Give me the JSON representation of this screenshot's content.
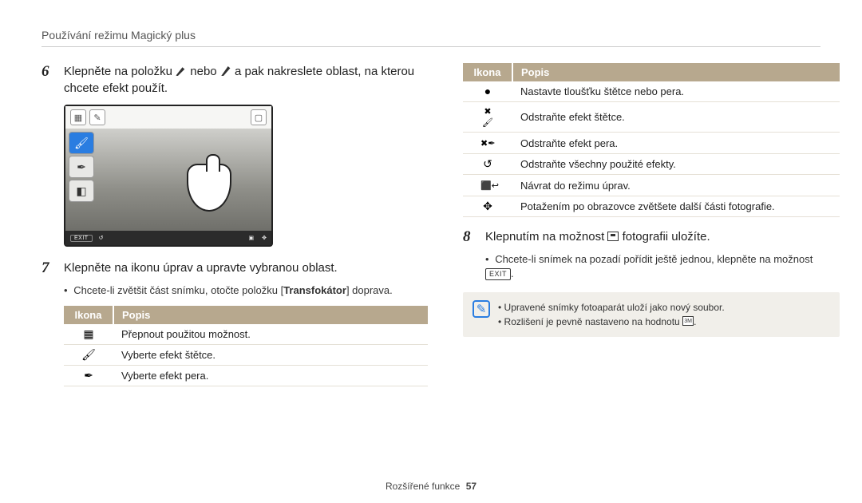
{
  "header": {
    "title": "Používání režimu Magický plus"
  },
  "left": {
    "step6": {
      "num": "6",
      "text_a": "Klepněte na položku",
      "text_b": "nebo",
      "text_c": "a pak nakreslete oblast, na kterou chcete efekt použít."
    },
    "illustration": {
      "bottom_exit": "EXIT"
    },
    "step7": {
      "num": "7",
      "text": "Klepněte na ikonu úprav a upravte vybranou oblast."
    },
    "bullet7": {
      "text_a": "Chcete-li zvětšit část snímku, otočte položku [",
      "strong": "Transfokátor",
      "text_b": "] doprava."
    },
    "table1": {
      "h1": "Ikona",
      "h2": "Popis",
      "rows": [
        {
          "glyph": "▦",
          "text": "Přepnout použitou možnost."
        },
        {
          "glyph": "🖌",
          "text": "Vyberte efekt štětce."
        },
        {
          "glyph": "✒",
          "text": "Vyberte efekt pera."
        }
      ]
    }
  },
  "right": {
    "table2": {
      "h1": "Ikona",
      "h2": "Popis",
      "rows": [
        {
          "glyph": "●",
          "text": "Nastavte tloušťku štětce nebo pera."
        },
        {
          "glyph": "✖🖌",
          "text": "Odstraňte efekt štětce."
        },
        {
          "glyph": "✖✒",
          "text": "Odstraňte efekt pera."
        },
        {
          "glyph": "↺",
          "text": "Odstraňte všechny použité efekty."
        },
        {
          "glyph": "⬛↩",
          "text": "Návrat do režimu úprav."
        },
        {
          "glyph": "✥",
          "text": "Potažením po obrazovce zvětšete další části fotografie."
        }
      ]
    },
    "step8": {
      "num": "8",
      "text_a": "Klepnutím na možnost",
      "text_b": "fotografii uložíte."
    },
    "bullet8": {
      "text": "Chcete-li snímek na pozadí pořídit ještě jednou, klepněte na možnost",
      "btn": "EXIT",
      "tail": "."
    },
    "note": {
      "line1": "Upravené snímky fotoaparát uloží jako nový soubor.",
      "line2_a": "Rozlišení je pevně nastaveno na hodnotu",
      "line2_b": "."
    }
  },
  "footer": {
    "label": "Rozšířené funkce",
    "page": "57"
  }
}
